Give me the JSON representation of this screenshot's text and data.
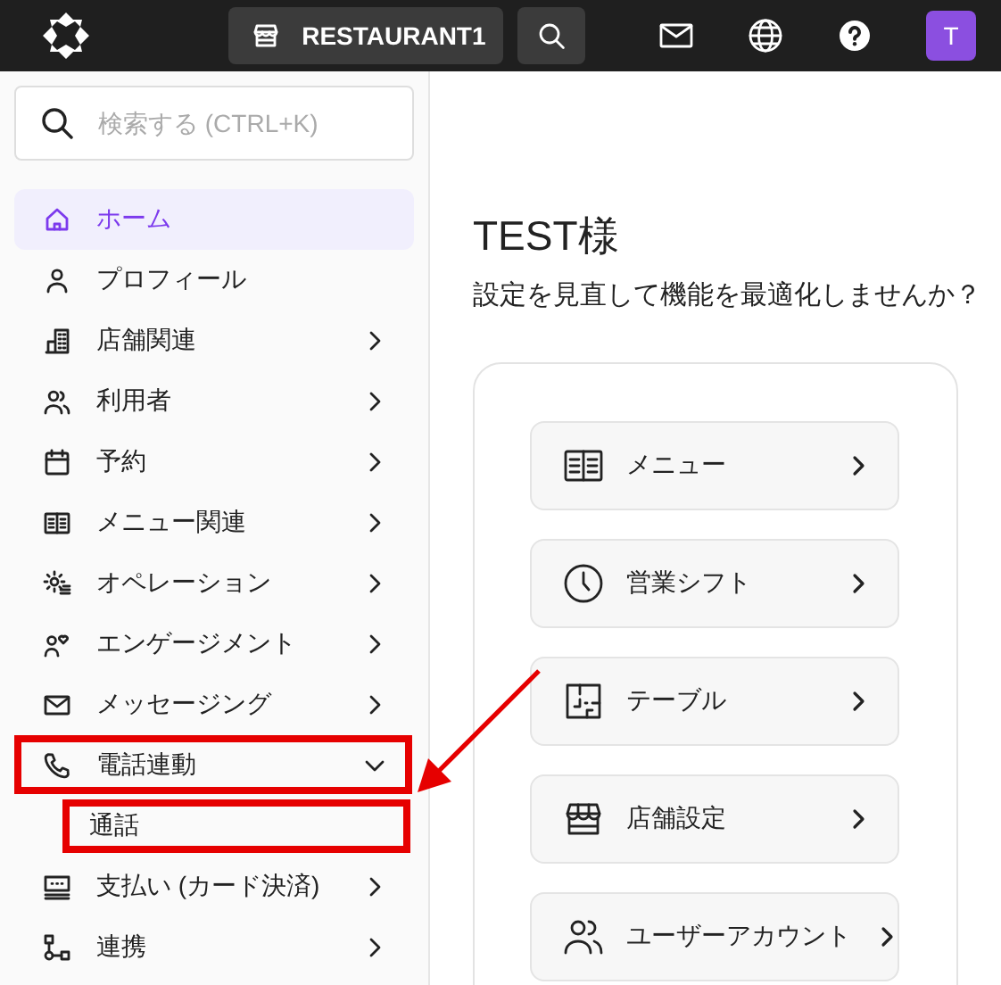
{
  "top_bar": {
    "store_name": "RESTAURANT1",
    "avatar_initial": "T"
  },
  "sidebar": {
    "search": {
      "placeholder": "検索する (CTRL+K)"
    },
    "items": [
      {
        "label": "ホーム",
        "kind": "link",
        "selected": true,
        "highlighted": false
      },
      {
        "label": "プロフィール",
        "kind": "link",
        "selected": false,
        "highlighted": false
      },
      {
        "label": "店舗関連",
        "kind": "group",
        "selected": false,
        "expanded": false,
        "highlighted": false
      },
      {
        "label": "利用者",
        "kind": "group",
        "selected": false,
        "expanded": false,
        "highlighted": false
      },
      {
        "label": "予約",
        "kind": "group",
        "selected": false,
        "expanded": false,
        "highlighted": false
      },
      {
        "label": "メニュー関連",
        "kind": "group",
        "selected": false,
        "expanded": false,
        "highlighted": false
      },
      {
        "label": "オペレーション",
        "kind": "group",
        "selected": false,
        "expanded": false,
        "highlighted": false
      },
      {
        "label": "エンゲージメント",
        "kind": "group",
        "selected": false,
        "expanded": false,
        "highlighted": false
      },
      {
        "label": "メッセージング",
        "kind": "group",
        "selected": false,
        "expanded": false,
        "highlighted": false
      },
      {
        "label": "電話連動",
        "kind": "group",
        "selected": false,
        "expanded": true,
        "highlighted": true,
        "children": [
          {
            "label": "通話",
            "selected": false,
            "highlighted": true
          }
        ]
      },
      {
        "label": "支払い (カード決済)",
        "kind": "group",
        "selected": false,
        "expanded": false,
        "highlighted": false
      },
      {
        "label": "連携",
        "kind": "group",
        "selected": false,
        "expanded": false,
        "highlighted": false
      }
    ]
  },
  "main": {
    "greeting": "TEST様",
    "subtitle": "設定を見直して機能を最適化しませんか？",
    "shortcuts": [
      {
        "label": "メニュー"
      },
      {
        "label": "営業シフト"
      },
      {
        "label": "テーブル"
      },
      {
        "label": "店舗設定"
      },
      {
        "label": "ユーザーアカウント"
      }
    ]
  },
  "callout_arrow": true
}
